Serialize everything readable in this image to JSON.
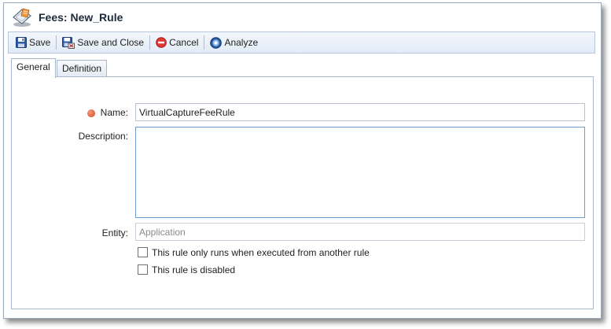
{
  "window": {
    "title": "Fees: New_Rule"
  },
  "toolbar": {
    "save_label": "Save",
    "save_close_label": "Save and Close",
    "cancel_label": "Cancel",
    "analyze_label": "Analyze"
  },
  "tabs": [
    {
      "label": "General",
      "active": true
    },
    {
      "label": "Definition",
      "active": false
    }
  ],
  "form": {
    "name_label": "Name:",
    "name_value": "VirtualCaptureFeeRule",
    "description_label": "Description:",
    "description_value": "",
    "entity_label": "Entity:",
    "entity_value": "Application",
    "checkbox_executed_label": "This rule only runs when executed from another rule",
    "checkbox_executed_checked": false,
    "checkbox_disabled_label": "This rule is disabled",
    "checkbox_disabled_checked": false
  },
  "colors": {
    "required_indicator": "#d2461f",
    "toolbar_bg": "#e2ebf6",
    "border": "#a9b7cb"
  }
}
